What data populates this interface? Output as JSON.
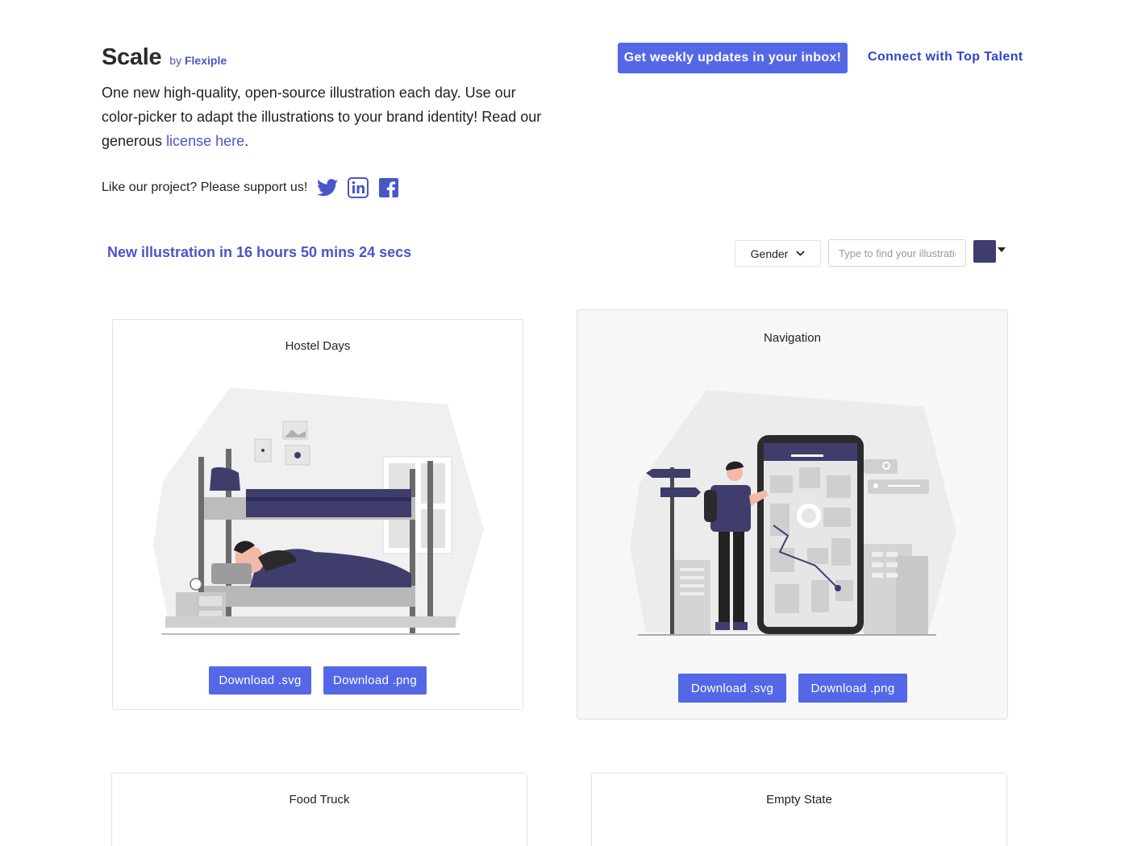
{
  "header": {
    "title": "Scale",
    "by_prefix": "by",
    "by_brand": "Flexiple",
    "intro_text": "One new high-quality, open-source illustration each day. Use our color-picker to adapt the illustrations to your brand identity! Read our generous ",
    "license_link": "license here",
    "intro_end": ".",
    "support_text": "Like our project? Please support us!",
    "cta_button": "Get weekly updates in your inbox!",
    "talent_link": "Connect with Top Talent"
  },
  "social": [
    {
      "icon": "twitter-icon"
    },
    {
      "icon": "linkedin-icon"
    },
    {
      "icon": "facebook-icon"
    }
  ],
  "toolbar": {
    "countdown": "New illustration in  16 hours 50 mins 24 secs",
    "gender_label": "Gender",
    "search_placeholder": "Type to find your illustration",
    "color": "#3f3d6b"
  },
  "colors": {
    "accent": "#5468e7",
    "illustration_primary": "#3f3d6b",
    "link": "#4a55c7"
  },
  "cards": [
    {
      "title": "Hostel Days",
      "svg_label": "Download .svg",
      "png_label": "Download .png"
    },
    {
      "title": "Navigation",
      "svg_label": "Download .svg",
      "png_label": "Download .png"
    },
    {
      "title": "Food Truck"
    },
    {
      "title": "Empty State"
    }
  ]
}
